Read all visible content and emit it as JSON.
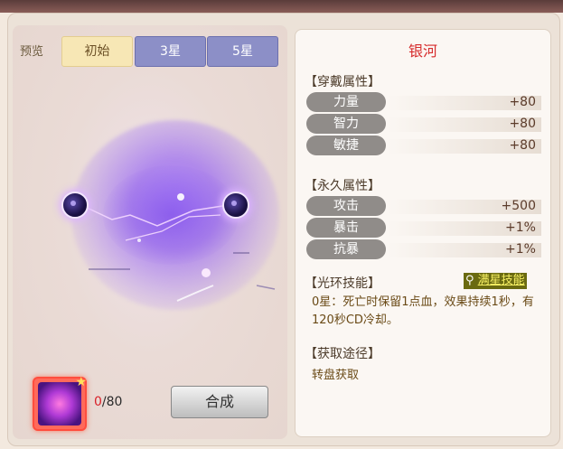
{
  "tabs": {
    "preview_label": "预览",
    "initial": "初始",
    "three_star": "3星",
    "five_star": "5星"
  },
  "item": {
    "count_current": "0",
    "count_total": "/80",
    "compose_label": "合成"
  },
  "info": {
    "title": "银河",
    "wear_section": "【穿戴属性】",
    "wear_stats": [
      {
        "name": "力量",
        "value": "+80"
      },
      {
        "name": "智力",
        "value": "+80"
      },
      {
        "name": "敏捷",
        "value": "+80"
      }
    ],
    "perm_section": "【永久属性】",
    "perm_stats": [
      {
        "name": "攻击",
        "value": "+500"
      },
      {
        "name": "暴击",
        "value": "+1%"
      },
      {
        "name": "抗暴",
        "value": "+1%"
      }
    ],
    "aura_section": "【光环技能】",
    "full_star_link": "满星技能",
    "aura_desc": "0星：死亡时保留1点血，效果持续1秒，有120秒CD冷却。",
    "obtain_section": "【获取途径】",
    "obtain_text": "转盘获取"
  },
  "colors": {
    "title_red": "#d62c2c",
    "tab_active": "#f7e7b5",
    "tab_inactive": "#8c8fc7",
    "count_red": "#d9222a"
  }
}
